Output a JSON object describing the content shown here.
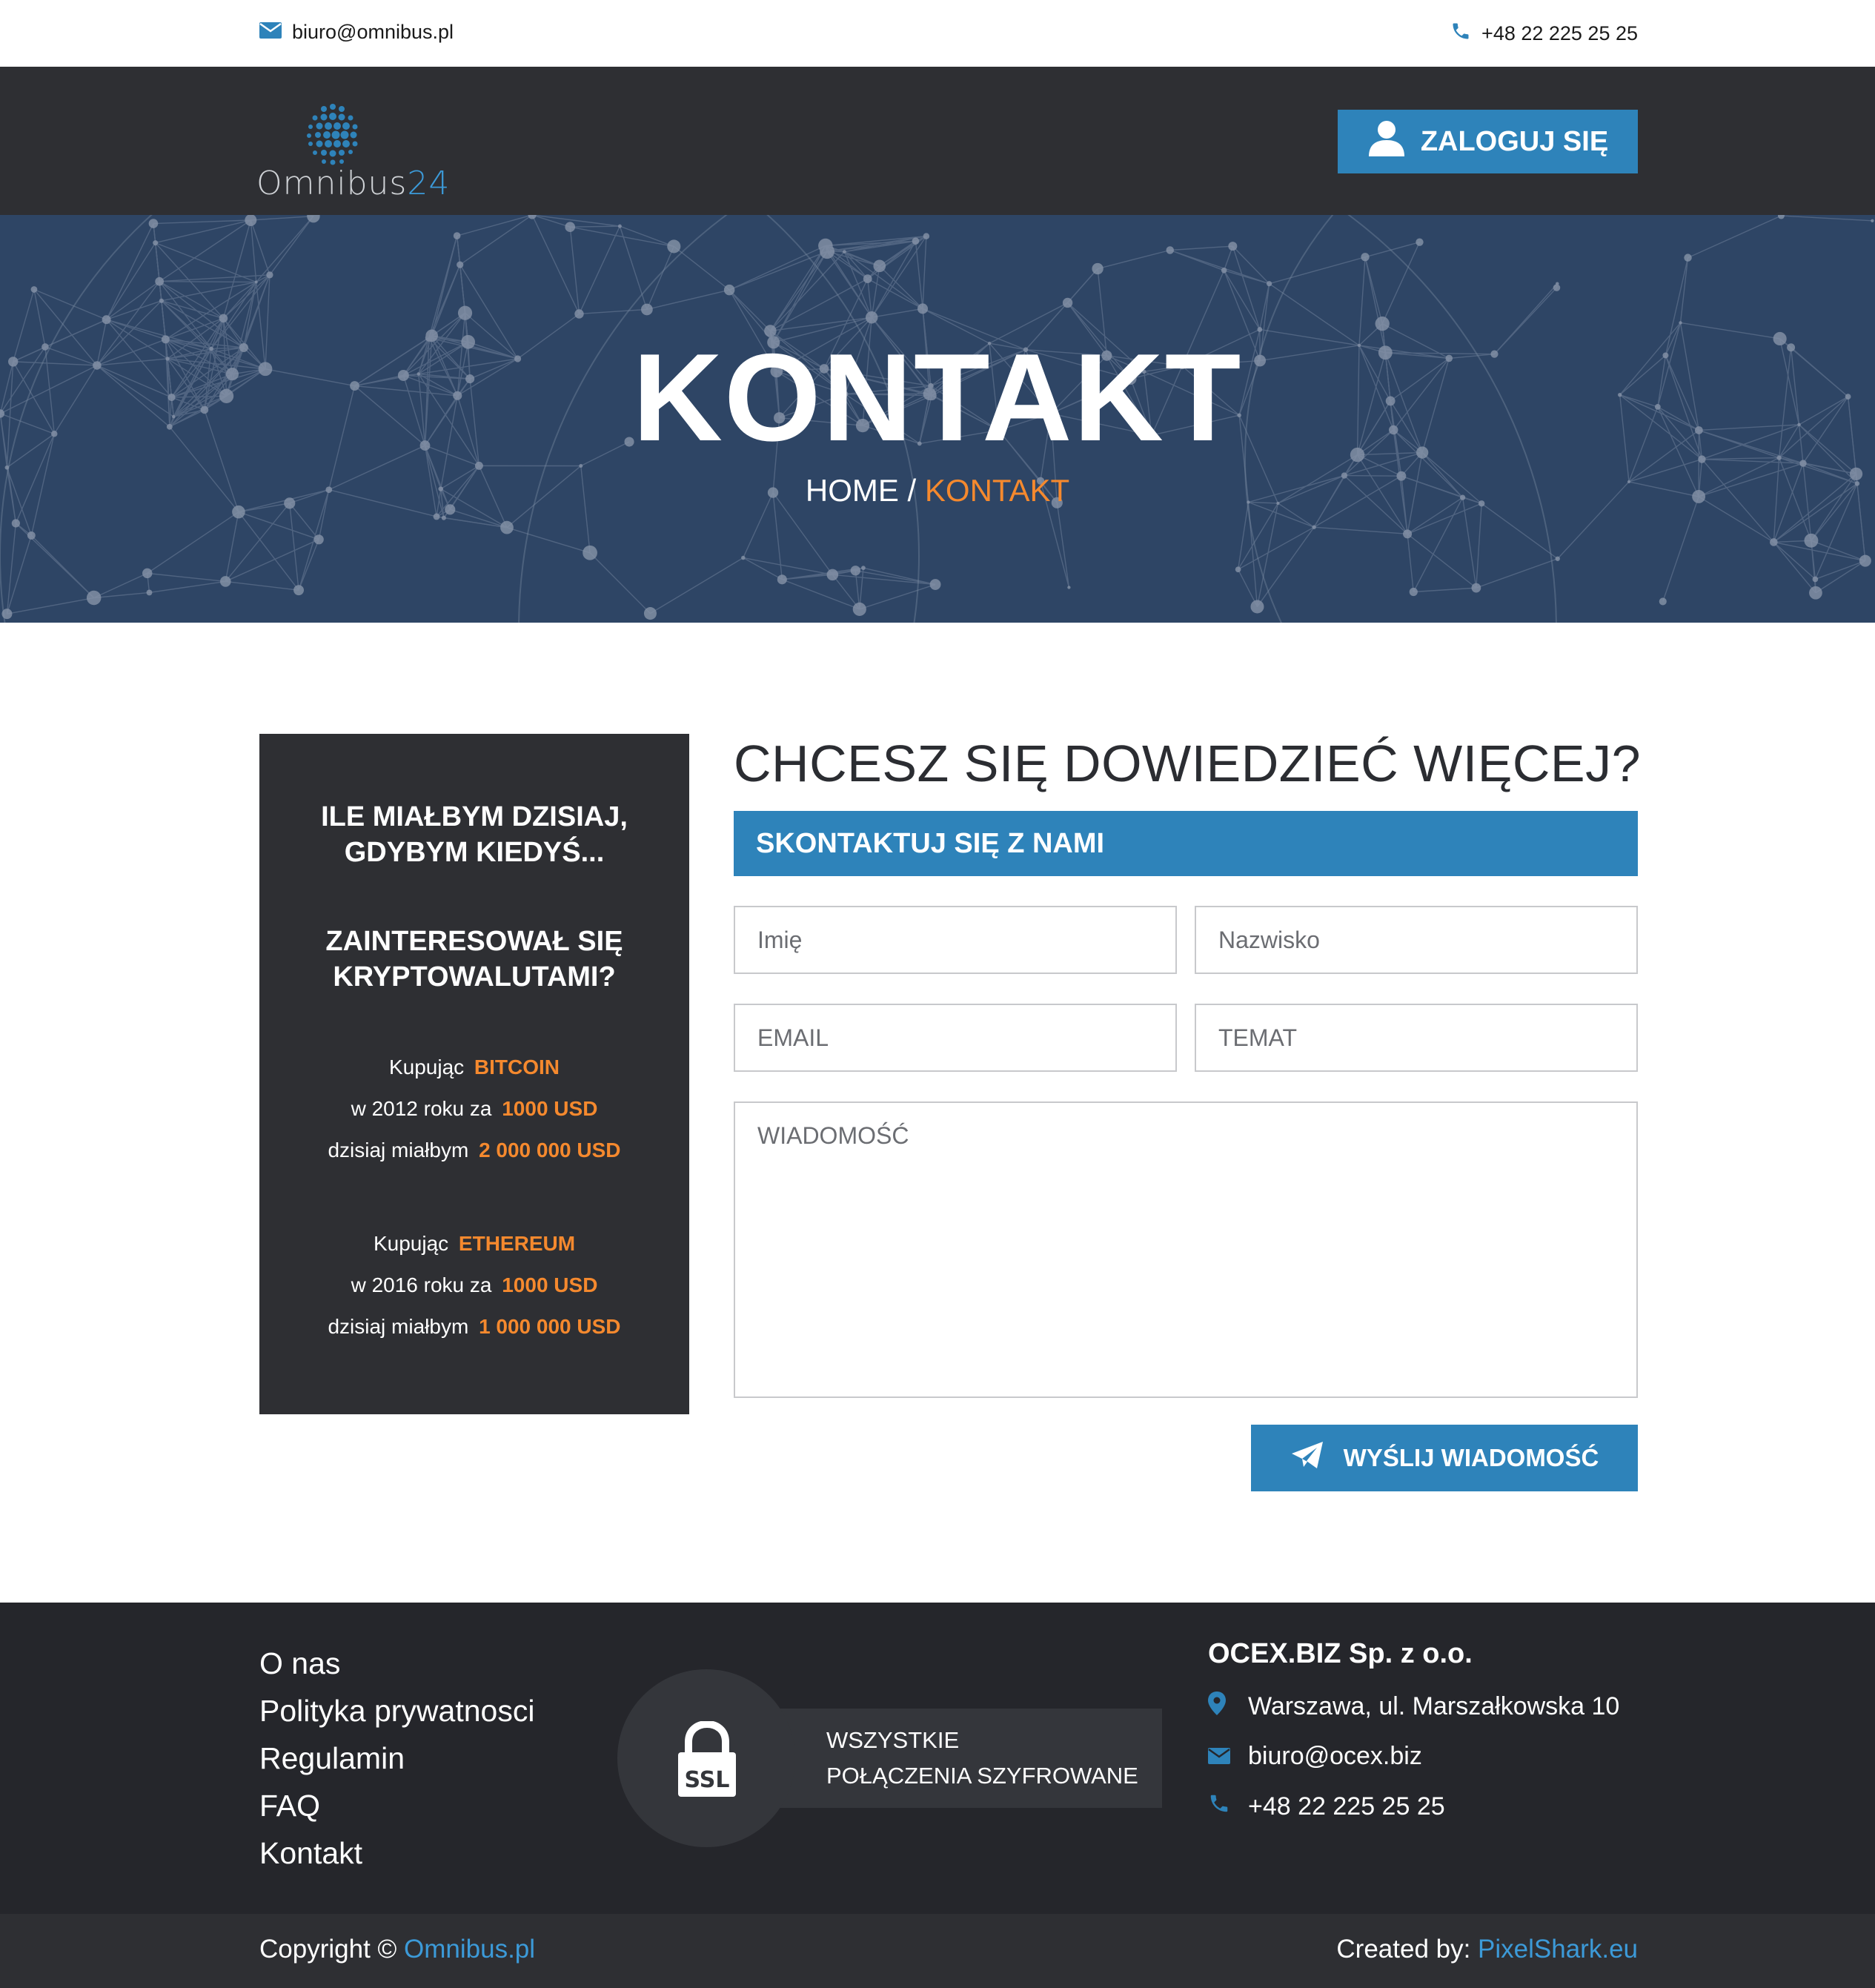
{
  "topbar": {
    "email": "biuro@omnibus.pl",
    "phone": "+48 22 225 25 25"
  },
  "header": {
    "logo_text": "Omnibus",
    "logo_number": "24",
    "login_label": "ZALOGUJ SIĘ"
  },
  "hero": {
    "title": "KONTAKT",
    "crumb_home": "HOME",
    "crumb_sep": " / ",
    "crumb_current": "KONTAKT"
  },
  "infobox": {
    "heading1_line1": "ILE MIAŁBYM DZISIAJ,",
    "heading1_line2": "GDYBYM KIEDYŚ...",
    "heading2_line1": "ZAINTERESOWAŁ SIĘ",
    "heading2_line2": "KRYPTOWALUTAMI?",
    "btc": {
      "buy": "Kupując",
      "coin": "BITCOIN",
      "year_text": "w 2012 roku za",
      "amount": "1000 USD",
      "today": "dzisiaj miałbym",
      "result": "2 000 000 USD"
    },
    "eth": {
      "buy": "Kupując",
      "coin": "ETHEREUM",
      "year_text": "w 2016 roku za",
      "amount": "1000 USD",
      "today": "dzisiaj miałbym",
      "result": "1 000 000 USD"
    }
  },
  "form": {
    "title": "CHCESZ SIĘ DOWIEDZIEĆ WIĘCEJ?",
    "bar_label": "SKONTAKTUJ SIĘ Z NAMI",
    "first_name_placeholder": "Imię",
    "last_name_placeholder": "Nazwisko",
    "email_placeholder": "EMAIL",
    "subject_placeholder": "TEMAT",
    "message_placeholder": "WIADOMOŚĆ",
    "send_label": "WYŚLIJ WIADOMOŚĆ"
  },
  "footer": {
    "links": [
      "O nas",
      "Polityka prywatnosci",
      "Regulamin",
      "FAQ",
      "Kontakt"
    ],
    "ssl_badge": "SSL",
    "ssl_line1": "WSZYSTKIE",
    "ssl_line2": "POŁĄCZENIA SZYFROWANE",
    "company": "OCEX.BIZ Sp. z o.o.",
    "address": "Warszawa, ul. Marszałkowska 10",
    "email": "biuro@ocex.biz",
    "phone": "+48 22 225 25 25",
    "copyright_prefix": "Copyright © ",
    "copyright_link": "Omnibus.pl",
    "created_prefix": "Created by: ",
    "created_link": "PixelShark.eu"
  },
  "colors": {
    "accent_blue": "#2e83ba",
    "accent_orange": "#f5892e",
    "dark": "#2e2f33",
    "hero_bg": "#2e4565"
  }
}
